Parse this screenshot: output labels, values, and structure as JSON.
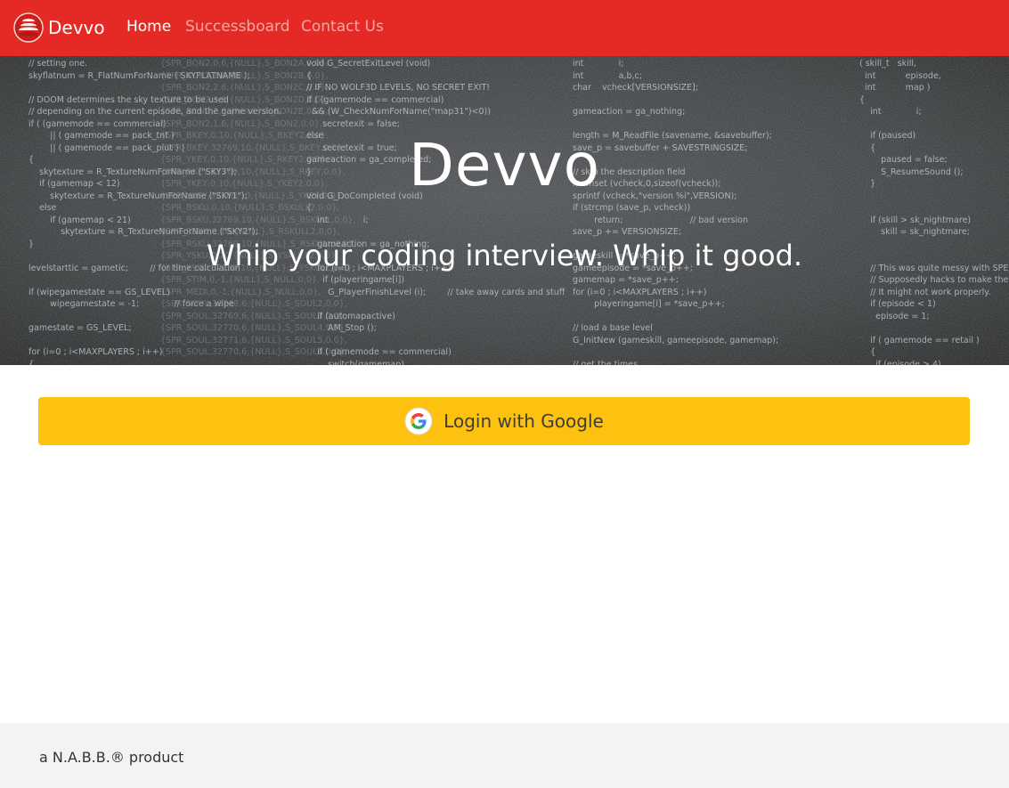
{
  "navbar": {
    "brand": "Devvo",
    "links": [
      {
        "label": "Home",
        "active": true
      },
      {
        "label": "Successboard",
        "active": false
      },
      {
        "label": "Contact Us",
        "active": false
      }
    ],
    "bg_color": "#e52a26"
  },
  "hero": {
    "title": "Devvo",
    "tagline": "Whip your coding interview. Whip it good.",
    "code_columns": [
      "// setting one.\nskyflatnum = R_FlatNumForName ( SKYFLATNAME );\n\n// DOOM determines the sky texture to be used\n// depending on the current episode, and the game version.\nif ( (gamemode == commercial)\n        || ( gamemode == pack_tnt )\n        || ( gamemode == pack_plut ) )\n{\n    skytexture = R_TextureNumForName (\"SKY3\");\n    if (gamemap < 12)\n        skytexture = R_TextureNumForName (\"SKY1\");\n    else\n        if (gamemap < 21)\n            skytexture = R_TextureNumForName (\"SKY2\");\n}\n\nlevelstarttic = gametic;        // for time calculation\n\nif (wipegamestate == GS_LEVEL)\n        wipegamestate = -1;             // force a wipe\n\ngamestate = GS_LEVEL;\n\nfor (i=0 ; i<MAXPLAYERS ; i++)\n{",
      "{SPR_BON2,0,6,{NULL},S_BON2A,0,0},\n{SPR_BON2,1,6,{NULL},S_BON2B,0,0},\n{SPR_BON2,2,6,{NULL},S_BON2C,0,0},\n{SPR_BON2,3,6,{NULL},S_BON2D,0,0},\n{SPR_BON2,2,6,{NULL},S_BON2E,0,0},\n{SPR_BON2,1,6,{NULL},S_BON2,0,0},\n{SPR_BKEY,0,10,{NULL},S_BKEY2,0,0},\n{SPR_BKEY,32769,10,{NULL},S_BKEY,0,0},\n{SPR_YKEY,0,10,{NULL},S_RKEY2,0,0},\n{SPR_RKEY,32769,10,{NULL},S_RKEY,0,0},\n{SPR_YKEY,0,10,{NULL},S_YKEY2,0,0},\n{SPR_YKEY,32769,10,{NULL},S_YKEY,0,0},\n{SPR_BSKU,0,10,{NULL},S_BSKULL2,0,0},\n{SPR_BSKU,32769,10,{NULL},S_BSKULL,0,0},\n{SPR_RSKU,0,10,{NULL},S_RSKULL2,0,0},\n{SPR_RSKU,32769,10,{NULL},S_RSKULL,0,0},\n{SPR_YSKU,0,10,{NULL},S_YSKULL2,0,0},\n{SPR_YSKU,32769,10,{NULL},S_YSKULL,0,0},\n{SPR_STIM,0,-1,{NULL},S_NULL,0,0},\n{SPR_MEDI,0,-1,{NULL},S_NULL,0,0},\n{SPR_SOUL,32768,6,{NULL},S_SOUL2,0,0},\n{SPR_SOUL,32769,6,{NULL},S_SOUL3,0,0},\n{SPR_SOUL,32770,6,{NULL},S_SOUL4,0,0},\n{SPR_SOUL,32771,6,{NULL},S_SOUL5,0,0},\n{SPR_SOUL,32770,6,{NULL},S_SOUL6,0,0},",
      "void G_SecretExitLevel (void)\n{\n// IF NO WOLF3D LEVELS, NO SECRET EXIT!\nif ( (gamemode == commercial)\n  && (W_CheckNumForName(\"map31\")<0))\n      secretexit = false;\nelse\n      secretexit = true;\ngameaction = ga_completed;\n}\n\nvoid G_DoCompleted (void)\n{\n    int             i;\n\n    gameaction = ga_nothing;\n\n    for (i=0 ; i<MAXPLAYERS ; i++)\n      if (playeringame[i])\n        G_PlayerFinishLevel (i);        // take away cards and stuff\n\n    if (automapactive)\n        AM_Stop ();\n\n    if ( gamemode == commercial)\n        switch(gamemap)",
      "int             i;\nint             a,b,c;\nchar    vcheck[VERSIONSIZE];\n\ngameaction = ga_nothing;\n\nlength = M_ReadFile (savename, &savebuffer);\nsave_p = savebuffer + SAVESTRINGSIZE;\n\n// skip the description field\nmemset (vcheck,0,sizeof(vcheck));\nsprintf (vcheck,\"version %i\",VERSION);\nif (strcmp (save_p, vcheck))\n        return;                         // bad version\nsave_p += VERSIONSIZE;\n\ngameskill = *save_p++;\ngameepisode = *save_p++;\ngamemap = *save_p++;\nfor (i=0 ; i<MAXPLAYERS ; i++)\n        playeringame[i] = *save_p++;\n\n// load a base level\nG_InitNew (gameskill, gameepisode, gamemap);\n\n// get the times",
      "( skill_t   skill,\n  int           episode,\n  int           map )\n{\n    int             i;\n\n    if (paused)\n    {\n        paused = false;\n        S_ResumeSound ();\n    }\n\n\n    if (skill > sk_nightmare)\n        skill = sk_nightmare;\n\n\n    // This was quite messy with SPECIAL and commented parts.\n    // Supposedly hacks to make the latest edition work.\n    // It might not work properly.\n    if (episode < 1)\n      episode = 1;\n\n    if ( gamemode == retail )\n    {\n      if (episode > 4)"
    ]
  },
  "login": {
    "label": "Login with Google",
    "icon": "google-icon",
    "bg_color": "#fdc110"
  },
  "footer": {
    "text": "a N.A.B.B.® product",
    "bg_color": "#f3f3f3"
  }
}
